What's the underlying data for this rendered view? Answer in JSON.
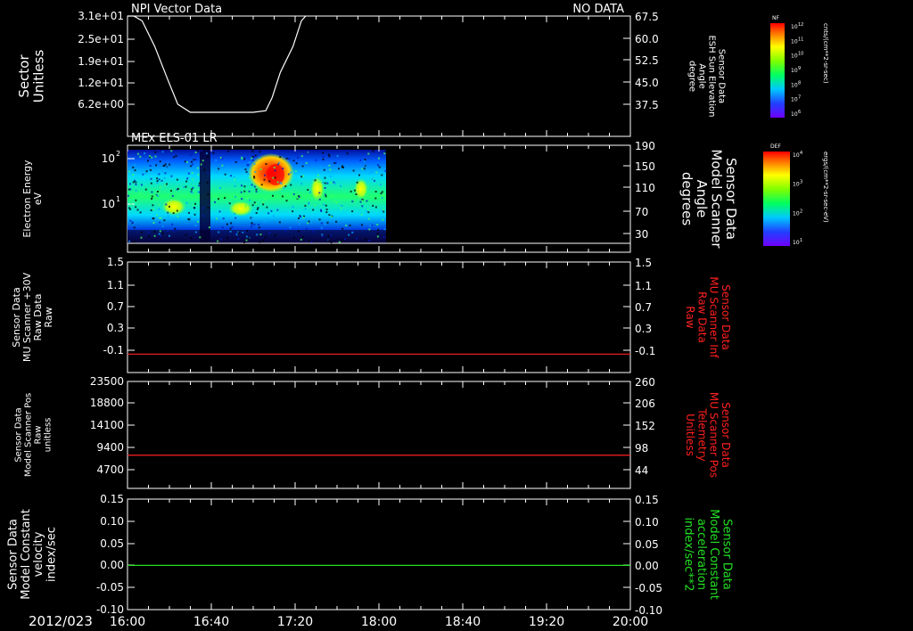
{
  "date_label": "2012/023",
  "x_ticks": [
    "16:00",
    "16:40",
    "17:20",
    "18:00",
    "18:40",
    "19:20",
    "20:00"
  ],
  "panels": [
    {
      "title": "NPI Vector Data",
      "status": "NO DATA",
      "left_label": [
        "Sector",
        "Unitless"
      ],
      "left_ticks": [
        "3.1e+01",
        "2.5e+01",
        "1.9e+01",
        "1.2e+01",
        "6.2e+00"
      ],
      "right_ticks": [
        "67.5",
        "60.0",
        "52.5",
        "45.0",
        "37.5"
      ],
      "right_label": [
        "Sensor Data",
        "ESH Sun Elevation",
        "Angle",
        "degree"
      ]
    },
    {
      "title": "MEx ELS-01 LR",
      "left_label": [
        "Electron Energy",
        "eV"
      ],
      "left_ticks_base": [
        "10",
        "10"
      ],
      "left_ticks_exp": [
        "2",
        "1"
      ],
      "right_ticks": [
        "190",
        "150",
        "110",
        "70",
        "30"
      ],
      "right_label": [
        "Sensor Data",
        "Model Scanner",
        "Angle",
        "degrees"
      ]
    },
    {
      "left_label": [
        "Sensor Data",
        "MU Scanner +30V",
        "Raw Data",
        "Raw"
      ],
      "left_ticks": [
        "1.5",
        "1.1",
        "0.7",
        "0.3",
        "-0.1"
      ],
      "right_ticks": [
        "1.5",
        "1.1",
        "0.7",
        "0.3",
        "-0.1"
      ],
      "right_label": [
        "Sensor Data",
        "MU Scanner Inf",
        "Raw Data",
        "Raw"
      ]
    },
    {
      "left_label": [
        "Sensor Data",
        "Model Scanner Pos",
        "Raw",
        "unitless"
      ],
      "left_ticks": [
        "23500",
        "18800",
        "14100",
        "9400",
        "4700"
      ],
      "right_ticks": [
        "260",
        "206",
        "152",
        "98",
        "44"
      ],
      "right_label": [
        "Sensor Data",
        "MU Scanner Pos",
        "Telemetry",
        "Unitless"
      ]
    },
    {
      "left_label": [
        "Sensor Data",
        "Model Constant",
        "velocity",
        "index/sec"
      ],
      "left_ticks": [
        "0.15",
        "0.10",
        "0.05",
        "0.00",
        "-0.05",
        "-0.10"
      ],
      "right_ticks": [
        "0.15",
        "0.10",
        "0.05",
        "0.00",
        "-0.05",
        "-0.10"
      ],
      "right_label": [
        "Sensor Data",
        "Model Constant",
        "acceleration",
        "index/sec**2"
      ]
    }
  ],
  "colorbars": [
    {
      "title": "NF",
      "units": "cnts/(cm**2-sr-sec)",
      "exps": [
        "12",
        "11",
        "10",
        "9",
        "8",
        "7",
        "6"
      ]
    },
    {
      "title": "DEF",
      "units": "ergs/(cm**2-sr-sec-eV)",
      "exps": [
        "4",
        "3",
        "2",
        "1"
      ]
    }
  ],
  "colors": {
    "red": "#ff2020",
    "green": "#22e022",
    "axis": "#ffffff"
  },
  "chart_data": [
    {
      "type": "line",
      "title": "NPI Vector Data",
      "annotation": "NO DATA",
      "xlabel": "",
      "ylabel": "Sector Unitless",
      "y2label": "Sensor Data ESH Sun Elevation Angle degree",
      "xlim": [
        "16:00",
        "20:00"
      ],
      "ylim": [
        0,
        31
      ],
      "y2lim": [
        30,
        67.5
      ],
      "series": [
        {
          "name": "",
          "x": [
            "16:00",
            "16:03",
            "16:07",
            "16:13",
            "16:19",
            "16:24",
            "16:30",
            "16:40",
            "16:50",
            "17:00",
            "17:06",
            "17:09",
            "17:13",
            "17:19",
            "17:23",
            "17:25"
          ],
          "y": [
            67.5,
            67.5,
            66,
            58,
            48,
            40,
            37.5,
            37.5,
            37.5,
            37.5,
            38,
            42,
            50,
            58,
            66,
            67.5
          ]
        }
      ]
    },
    {
      "type": "heatmap",
      "title": "MEx ELS-01 LR",
      "xlabel": "",
      "ylabel": "Electron Energy eV",
      "y2label": "Sensor Data Model Scanner Angle degrees",
      "xlim": [
        "16:00",
        "20:00"
      ],
      "y_scale": "log",
      "colorbar": "DEF",
      "data_coverage": [
        "16:00",
        "18:02"
      ],
      "x": [
        "16:00",
        "16:10",
        "16:20",
        "16:30",
        "16:40",
        "16:50",
        "17:00",
        "17:10",
        "17:20",
        "17:30",
        "17:40",
        "17:50",
        "18:00"
      ],
      "y": [
        2,
        5,
        10,
        20,
        50,
        100,
        150
      ],
      "z_log_def": [
        [
          1.6,
          1.6,
          1.7,
          1.8,
          1.4,
          1.8,
          1.8,
          1.8,
          1.8,
          1.6,
          1.6,
          1.6,
          1.6
        ],
        [
          2.0,
          2.0,
          2.1,
          2.2,
          1.6,
          2.3,
          2.3,
          2.2,
          2.2,
          2.0,
          2.0,
          2.0,
          2.0
        ],
        [
          2.6,
          2.6,
          2.7,
          2.8,
          1.8,
          2.7,
          2.8,
          2.9,
          2.8,
          2.5,
          2.6,
          2.6,
          2.6
        ],
        [
          2.5,
          2.5,
          2.6,
          2.6,
          1.8,
          2.6,
          2.8,
          3.1,
          3.0,
          2.6,
          2.7,
          2.6,
          2.5
        ],
        [
          2.3,
          2.3,
          2.3,
          2.4,
          1.7,
          2.5,
          3.0,
          3.6,
          3.3,
          2.7,
          2.6,
          2.5,
          2.3
        ],
        [
          2.0,
          2.0,
          2.0,
          2.1,
          1.6,
          2.2,
          3.1,
          3.8,
          3.4,
          2.5,
          2.3,
          2.1,
          2.0
        ],
        [
          1.7,
          1.7,
          1.8,
          1.8,
          1.5,
          1.9,
          2.7,
          3.2,
          2.7,
          2.1,
          1.9,
          1.8,
          1.7
        ]
      ]
    },
    {
      "type": "line",
      "xlabel": "",
      "ylabel": "Sensor Data MU Scanner +30V Raw Data Raw",
      "y2label": "Sensor Data MU Scanner Inf Raw Data Raw",
      "xlim": [
        "16:00",
        "20:00"
      ],
      "ylim": [
        -0.3,
        1.5
      ],
      "series": [
        {
          "name": "",
          "color": "red",
          "x": [
            "16:00",
            "20:00"
          ],
          "y": [
            0,
            0
          ]
        }
      ]
    },
    {
      "type": "line",
      "xlabel": "",
      "ylabel": "Sensor Data Model Scanner Pos Raw unitless",
      "y2label": "Sensor Data MU Scanner Pos Telemetry Unitless",
      "xlim": [
        "16:00",
        "20:00"
      ],
      "ylim": [
        0,
        23500
      ],
      "series": [
        {
          "name": "",
          "color": "red",
          "x": [
            "16:00",
            "20:00"
          ],
          "y": [
            7300,
            7300
          ]
        }
      ]
    },
    {
      "type": "line",
      "xlabel": "",
      "ylabel": "Sensor Data Model Constant velocity index/sec",
      "y2label": "Sensor Data Model Constant acceleration index/sec**2",
      "xlim": [
        "16:00",
        "20:00"
      ],
      "ylim": [
        -0.1,
        0.15
      ],
      "series": [
        {
          "name": "",
          "color": "green",
          "x": [
            "16:00",
            "20:00"
          ],
          "y": [
            0.0,
            0.0
          ]
        }
      ]
    }
  ]
}
